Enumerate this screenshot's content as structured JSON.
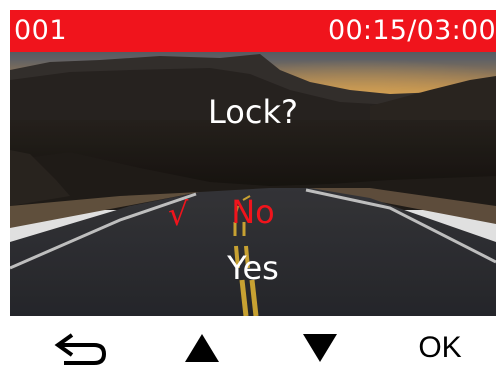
{
  "status_bar": {
    "clip_number": "001",
    "playback_time": "00:15/03:00",
    "background_color": "#f0141c"
  },
  "dialog": {
    "title": "Lock?",
    "options": [
      {
        "label": "No",
        "selected": true,
        "color": "#f0141c"
      },
      {
        "label": "Yes",
        "selected": false,
        "color": "#ffffff"
      }
    ],
    "selected_mark": "√"
  },
  "toolbar": {
    "back_icon": "return-arrow-icon",
    "up_icon": "triangle-up-icon",
    "down_icon": "triangle-down-icon",
    "ok_label": "OK"
  }
}
